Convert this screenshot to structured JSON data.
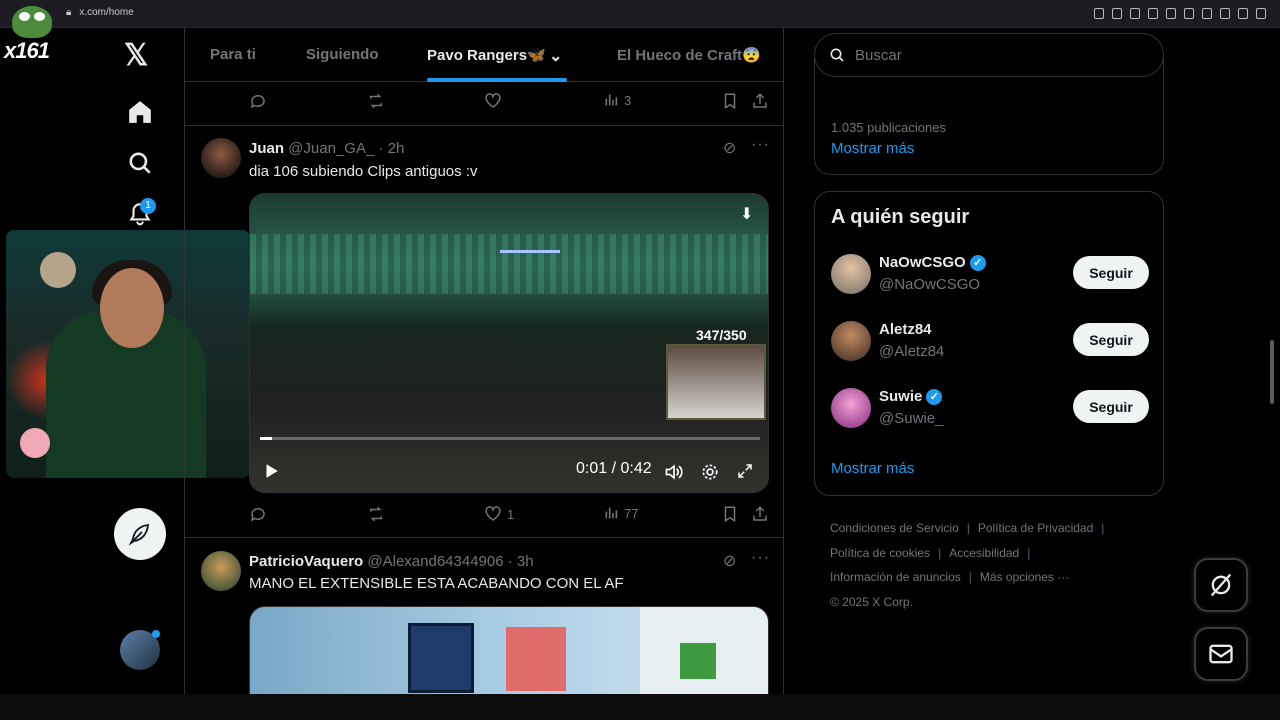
{
  "browser": {
    "url": "x.com/home"
  },
  "stream_overlay": {
    "channel_tag": "x161"
  },
  "nav": {
    "notifications_badge": "1"
  },
  "tabs": [
    {
      "label": "Para ti"
    },
    {
      "label": "Siguiendo"
    },
    {
      "label": "Pavo Rangers🦋"
    },
    {
      "label": "El Hueco de Craft😨"
    }
  ],
  "prev_tweet": {
    "views": "3"
  },
  "tweet1": {
    "name": "Juan",
    "handle": "@Juan_GA_",
    "time": "· 2h",
    "text": "dia 106 subiendo Clips antiguos :v",
    "video": {
      "hp": "347/350",
      "time": "0:01 / 0:42",
      "progress": 0.024
    },
    "likes": "1",
    "views": "77"
  },
  "tweet2": {
    "name": "PatricioVaquero",
    "handle": "@Alexand64344906",
    "time": "· 3h",
    "text": "MANO EL EXTENSIBLE ESTA ACABANDO CON EL AF"
  },
  "search": {
    "placeholder": "Buscar"
  },
  "trend_card": {
    "posts": "1.035 publicaciones",
    "show_more": "Mostrar más"
  },
  "who_to_follow": {
    "title": "A quién seguir",
    "users": [
      {
        "name": "NaOwCSGO",
        "handle": "@NaOwCSGO",
        "verified": true,
        "button": "Seguir"
      },
      {
        "name": "Aletz84",
        "handle": "@Aletz84",
        "verified": false,
        "button": "Seguir"
      },
      {
        "name": "Suwie",
        "handle": "@Suwie_",
        "verified": true,
        "button": "Seguir"
      }
    ],
    "show_more": "Mostrar más"
  },
  "footer": {
    "terms": "Condiciones de Servicio",
    "privacy": "Política de Privacidad",
    "cookies": "Política de cookies",
    "accessibility": "Accesibilidad",
    "ads": "Información de anuncios",
    "more": "Más opciones ···",
    "copyright": "© 2025 X Corp."
  },
  "colors": {
    "accent": "#1d9bf0",
    "background": "#000000",
    "border": "#2f3336",
    "muted": "#71767b"
  }
}
